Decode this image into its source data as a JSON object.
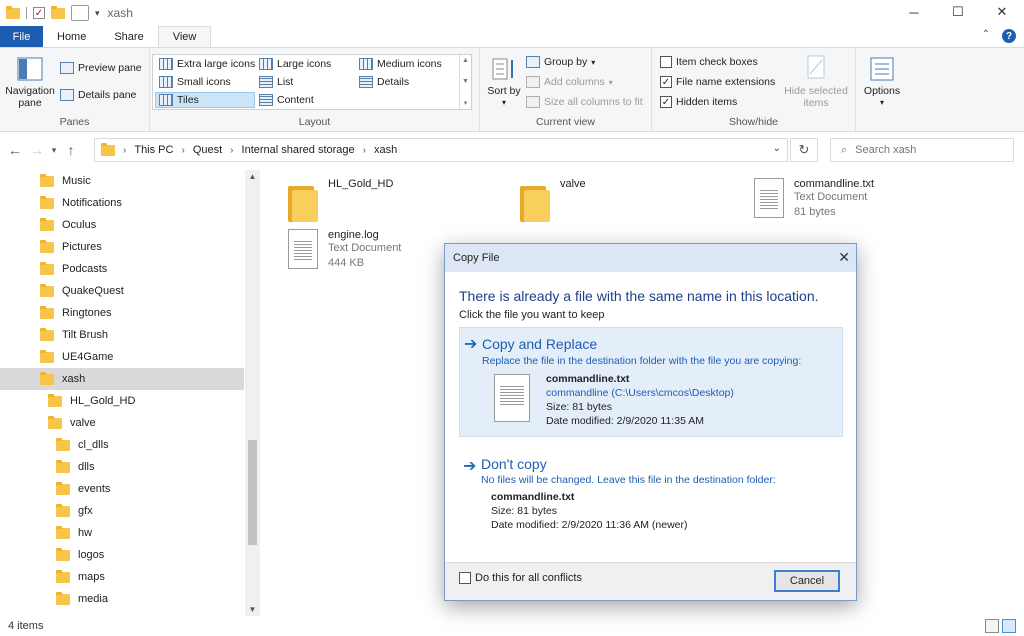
{
  "window": {
    "title": "xash"
  },
  "titlebar": {
    "minimize": "─",
    "maximize": "☐",
    "close": "✕"
  },
  "tabs": {
    "file": "File",
    "home": "Home",
    "share": "Share",
    "view": "View"
  },
  "ribbon": {
    "panes": {
      "label": "Panes",
      "navigation_pane": "Navigation pane",
      "preview_pane": "Preview pane",
      "details_pane": "Details pane"
    },
    "layout": {
      "label": "Layout",
      "items": [
        "Extra large icons",
        "Large icons",
        "Medium icons",
        "Small icons",
        "List",
        "Details",
        "Tiles",
        "Content"
      ],
      "selected": "Tiles"
    },
    "current_view": {
      "label": "Current view",
      "sort_by": "Sort by",
      "group_by": "Group by",
      "add_columns": "Add columns",
      "size_columns": "Size all columns to fit"
    },
    "show_hide": {
      "label": "Show/hide",
      "item_check_boxes": "Item check boxes",
      "item_check_boxes_checked": false,
      "file_name_extensions": "File name extensions",
      "file_name_extensions_checked": true,
      "hidden_items": "Hidden items",
      "hidden_items_checked": true,
      "hide_selected": "Hide selected items"
    },
    "options": {
      "label": "Options"
    }
  },
  "address": {
    "breadcrumb": [
      "This PC",
      "Quest",
      "Internal shared storage",
      "xash"
    ],
    "search_placeholder": "Search xash"
  },
  "nav": {
    "items": [
      {
        "label": "Music",
        "indent": 0
      },
      {
        "label": "Notifications",
        "indent": 0
      },
      {
        "label": "Oculus",
        "indent": 0
      },
      {
        "label": "Pictures",
        "indent": 0
      },
      {
        "label": "Podcasts",
        "indent": 0
      },
      {
        "label": "QuakeQuest",
        "indent": 0
      },
      {
        "label": "Ringtones",
        "indent": 0
      },
      {
        "label": "Tilt Brush",
        "indent": 0
      },
      {
        "label": "UE4Game",
        "indent": 0
      },
      {
        "label": "xash",
        "indent": 0,
        "selected": true
      },
      {
        "label": "HL_Gold_HD",
        "indent": 1
      },
      {
        "label": "valve",
        "indent": 1
      },
      {
        "label": "cl_dlls",
        "indent": 2
      },
      {
        "label": "dlls",
        "indent": 2
      },
      {
        "label": "events",
        "indent": 2
      },
      {
        "label": "gfx",
        "indent": 2
      },
      {
        "label": "hw",
        "indent": 2
      },
      {
        "label": "logos",
        "indent": 2
      },
      {
        "label": "maps",
        "indent": 2
      },
      {
        "label": "media",
        "indent": 2
      }
    ]
  },
  "files": [
    {
      "name": "HL_Gold_HD",
      "type": "folder"
    },
    {
      "name": "valve",
      "type": "folder"
    },
    {
      "name": "commandline.txt",
      "type": "doc",
      "kind": "Text Document",
      "size": "81 bytes"
    },
    {
      "name": "engine.log",
      "type": "doc",
      "kind": "Text Document",
      "size": "444 KB"
    }
  ],
  "status": {
    "count": "4 items"
  },
  "dialog": {
    "title": "Copy File",
    "heading": "There is already a file with the same name in this location.",
    "subheading": "Click the file you want to keep",
    "replace": {
      "title": "Copy and Replace",
      "desc": "Replace the file in the destination folder with the file you are copying:",
      "file_name": "commandline.txt",
      "file_path": "commandline (C:\\Users\\cmcos\\Desktop)",
      "size": "Size: 81 bytes",
      "modified": "Date modified: 2/9/2020 11:35 AM"
    },
    "dont_copy": {
      "title": "Don't copy",
      "desc": "No files will be changed. Leave this file in the destination folder:",
      "file_name": "commandline.txt",
      "size": "Size: 81 bytes",
      "modified": "Date modified: 2/9/2020 11:36 AM (newer)"
    },
    "all_conflicts": "Do this for all conflicts",
    "cancel": "Cancel"
  }
}
